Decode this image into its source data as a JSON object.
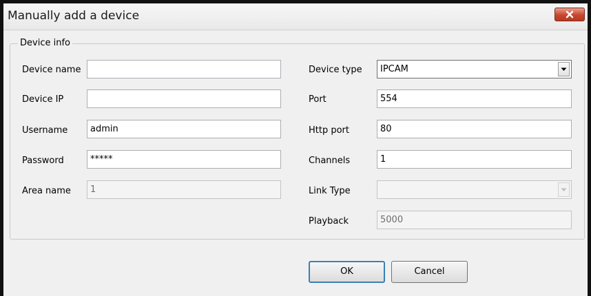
{
  "window": {
    "title": "Manually add a device"
  },
  "group": {
    "legend": "Device info"
  },
  "left_fields": {
    "device_name": {
      "label": "Device name",
      "value": ""
    },
    "device_ip": {
      "label": "Device IP",
      "value": ""
    },
    "username": {
      "label": "Username",
      "value": "admin"
    },
    "password": {
      "label": "Password",
      "value": "*****"
    },
    "area_name": {
      "label": "Area name",
      "value": "1"
    }
  },
  "right_fields": {
    "device_type": {
      "label": "Device type",
      "value": "IPCAM"
    },
    "port": {
      "label": "Port",
      "value": "554"
    },
    "http_port": {
      "label": "Http port",
      "value": "80"
    },
    "channels": {
      "label": "Channels",
      "value": "1"
    },
    "link_type": {
      "label": "Link Type",
      "value": ""
    },
    "playback": {
      "label": "Playback",
      "value": "5000"
    }
  },
  "buttons": {
    "ok": "OK",
    "cancel": "Cancel"
  },
  "colors": {
    "close_button": "#c7462f",
    "default_button_border": "#3c7fb1"
  }
}
